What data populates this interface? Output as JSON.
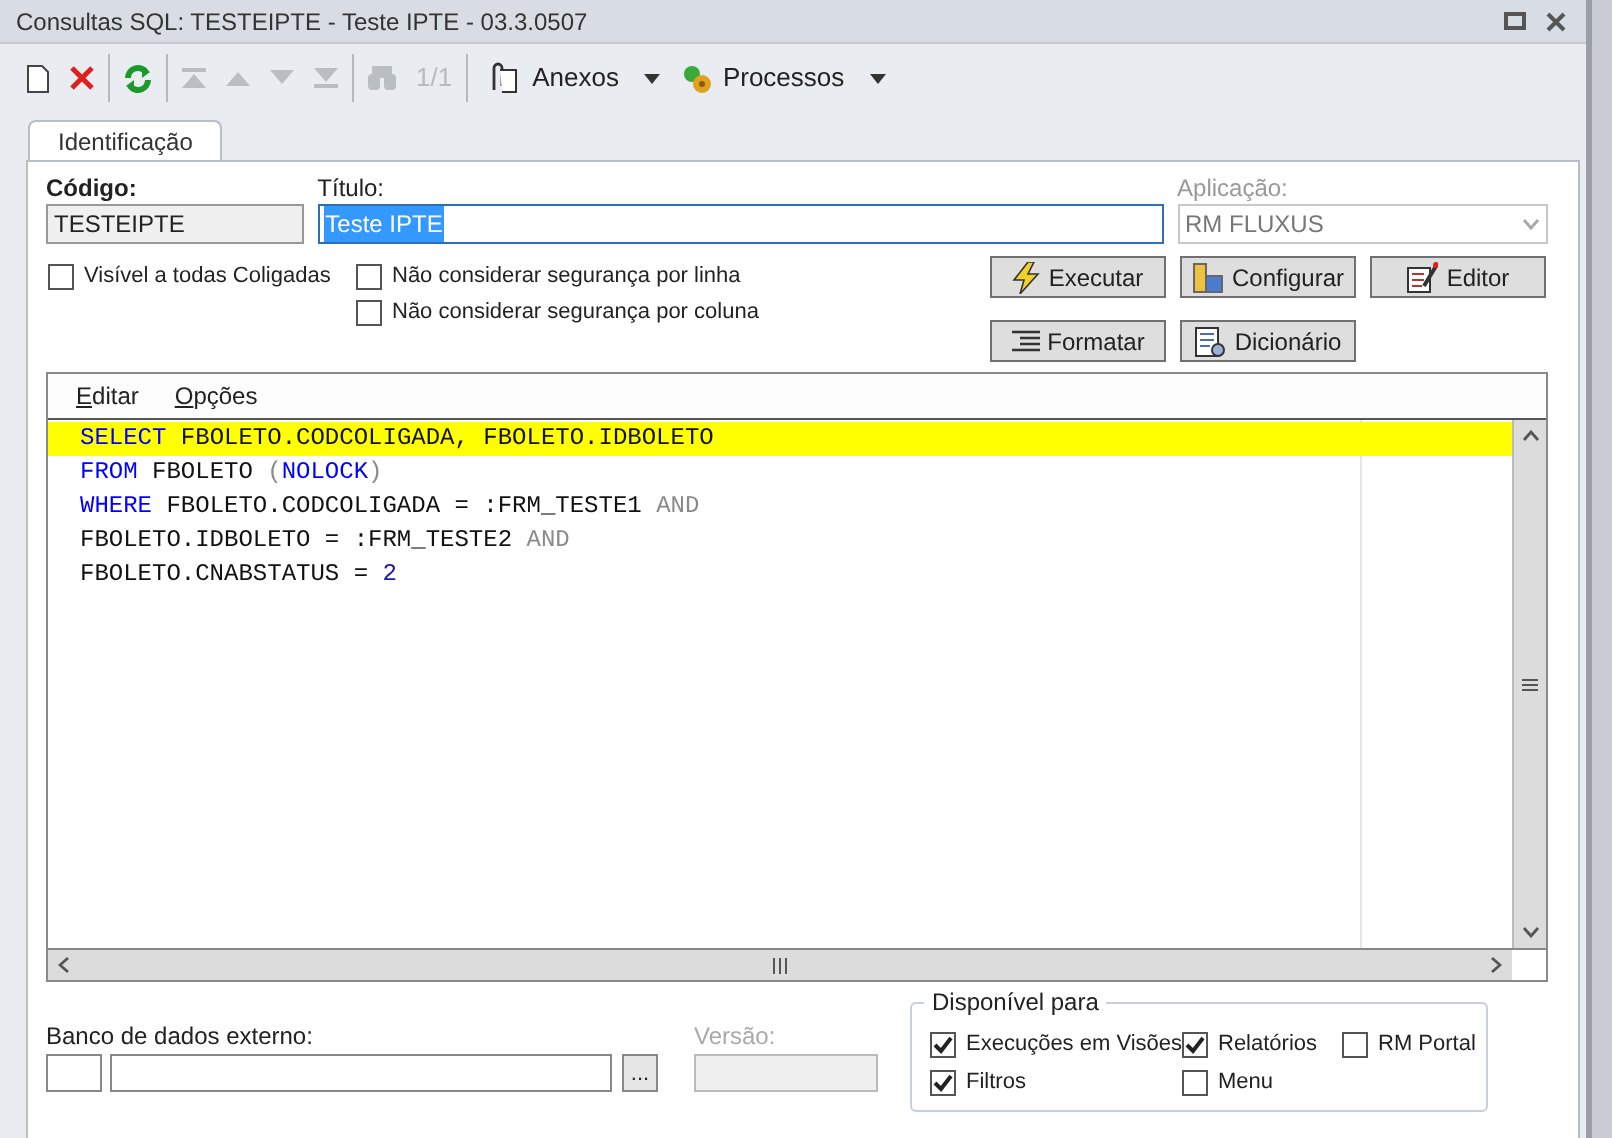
{
  "window": {
    "title": "Consultas SQL: TESTEIPTE - Teste IPTE - 03.3.0507"
  },
  "toolbar": [
    {
      "kind": "new",
      "disabled": false
    },
    {
      "kind": "delete",
      "disabled": false
    },
    {
      "kind": "refresh",
      "disabled": false
    },
    {
      "kind": "first",
      "disabled": true
    },
    {
      "kind": "prev",
      "disabled": true
    },
    {
      "kind": "next",
      "disabled": true
    },
    {
      "kind": "last",
      "disabled": true
    },
    {
      "kind": "find",
      "disabled": true
    },
    {
      "kind": "counter",
      "label": "1/1",
      "disabled": true
    },
    {
      "kind": "attachments",
      "label": "Anexos",
      "disabled": false
    },
    {
      "kind": "processes",
      "label": "Processos",
      "disabled": false
    }
  ],
  "tabs": [
    {
      "label": "Identificação",
      "selected": true
    }
  ],
  "fields": {
    "codigo": {
      "label": "Código:",
      "value": "TESTEIPTE"
    },
    "titulo": {
      "label": "Título:",
      "value": "Teste IPTE",
      "text_selected": true
    },
    "aplicacao": {
      "label": "Aplicação:",
      "value": "RM FLUXUS",
      "disabled": true
    }
  },
  "options": [
    {
      "label": "Visível a todas Coligadas",
      "checked": false
    },
    {
      "label": "Não considerar segurança por linha",
      "checked": false
    },
    {
      "label": "Não considerar segurança por coluna",
      "checked": false
    }
  ],
  "buttons": [
    {
      "kind": "executar",
      "label": "Executar"
    },
    {
      "kind": "configurar",
      "label": "Configurar"
    },
    {
      "kind": "editor",
      "label": "Editor"
    },
    {
      "kind": "formatar",
      "label": "Formatar"
    },
    {
      "kind": "dicionario",
      "label": "Dicionário"
    }
  ],
  "editor": {
    "menu": [
      {
        "label": "Editar"
      },
      {
        "label": "Opções"
      }
    ],
    "lines": [
      {
        "highlighted": true,
        "tokens": [
          {
            "kind": "keyword",
            "text": "SELECT"
          },
          {
            "kind": "text",
            "text": " FBOLETO.CODCOLIGADA, FBOLETO.IDBOLETO"
          }
        ]
      },
      {
        "highlighted": false,
        "tokens": [
          {
            "kind": "keyword",
            "text": "FROM"
          },
          {
            "kind": "text",
            "text": " FBOLETO "
          },
          {
            "kind": "muted",
            "text": "("
          },
          {
            "kind": "keyword",
            "text": "NOLOCK"
          },
          {
            "kind": "muted",
            "text": ")"
          }
        ]
      },
      {
        "highlighted": false,
        "tokens": [
          {
            "kind": "keyword",
            "text": "WHERE"
          },
          {
            "kind": "text",
            "text": " FBOLETO.CODCOLIGADA = :FRM_TESTE1 "
          },
          {
            "kind": "muted",
            "text": "AND"
          }
        ]
      },
      {
        "highlighted": false,
        "tokens": [
          {
            "kind": "text",
            "text": "FBOLETO.IDBOLETO = :FRM_TESTE2 "
          },
          {
            "kind": "muted",
            "text": "AND"
          }
        ]
      },
      {
        "highlighted": false,
        "tokens": [
          {
            "kind": "text",
            "text": "FBOLETO.CNABSTATUS = "
          },
          {
            "kind": "number",
            "text": "2"
          }
        ]
      }
    ]
  },
  "external_db": {
    "label": "Banco de dados externo:",
    "browse": "..."
  },
  "version": {
    "label": "Versão:",
    "disabled": true
  },
  "available_for": {
    "title": "Disponível para",
    "items": [
      {
        "label": "Execuções em Visões",
        "checked": true
      },
      {
        "label": "Relatórios",
        "checked": true
      },
      {
        "label": "RM Portal",
        "checked": false
      },
      {
        "label": "Filtros",
        "checked": true
      },
      {
        "label": "Menu",
        "checked": false
      }
    ]
  }
}
